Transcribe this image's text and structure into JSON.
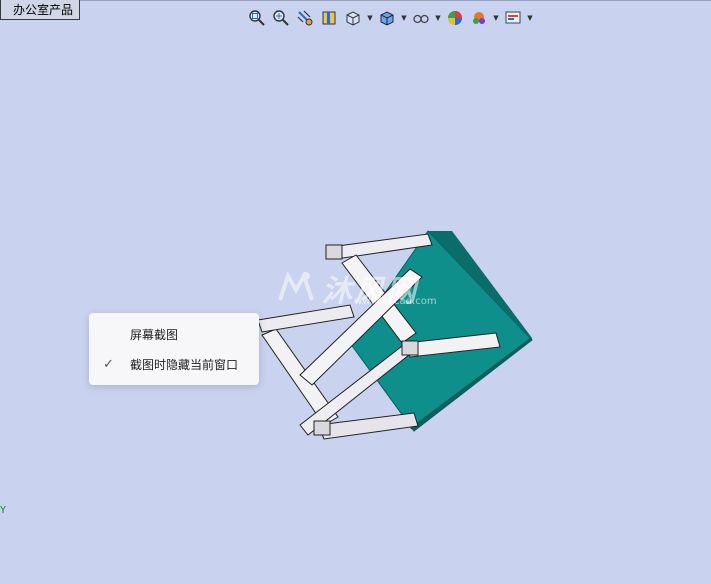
{
  "tab": {
    "label": "办公室产品"
  },
  "toolbar": {
    "items": [
      "zoom-to-fit-icon",
      "zoom-to-area-icon",
      "previous-view-icon",
      "section-view-icon",
      "view-orientation-icon",
      "display-style-icon",
      "hide-show-items-icon",
      "edit-appearance-icon",
      "apply-scene-icon",
      "view-settings-icon"
    ]
  },
  "watermark": {
    "text": "沐风网",
    "url": "www.mfcad.com"
  },
  "context_menu": {
    "items": [
      {
        "label": "屏幕截图",
        "checked": false
      },
      {
        "label": "截图时隐藏当前窗口",
        "checked": true
      }
    ]
  },
  "triad": {
    "axis_label": "Y"
  },
  "colors": {
    "background": "#c9d2ef",
    "panel": "#0e8f8c",
    "frame": "#f4f4f6"
  }
}
